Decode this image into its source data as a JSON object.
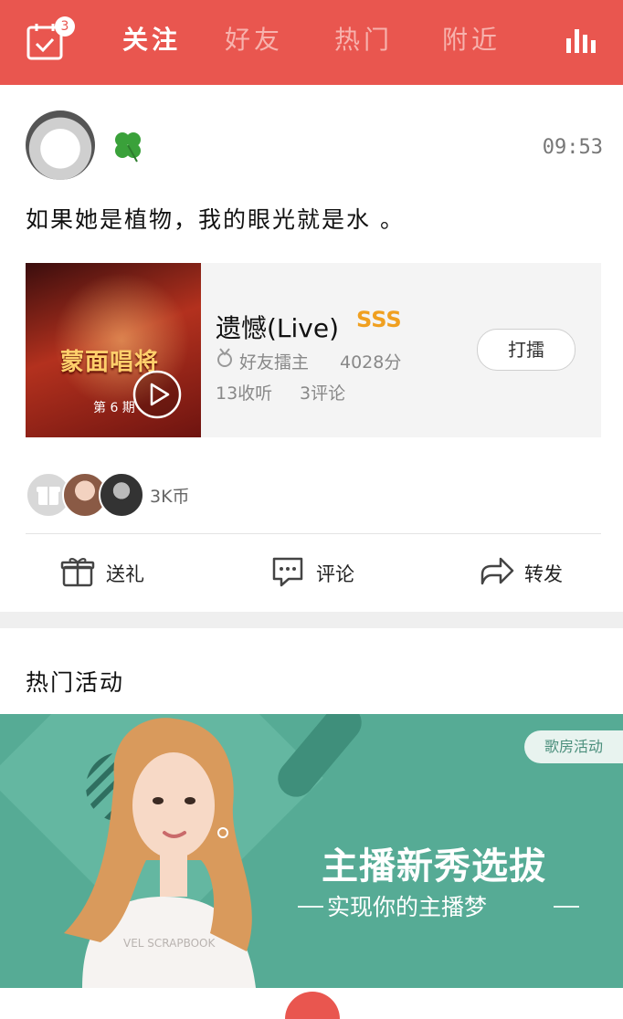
{
  "topbar": {
    "checkin_badge": "3",
    "tabs": [
      {
        "label": "关注",
        "active": true
      },
      {
        "label": "好友",
        "active": false
      },
      {
        "label": "热门",
        "active": false
      },
      {
        "label": "附近",
        "active": false
      }
    ],
    "icons": {
      "left": "calendar-check-icon",
      "right": "bar-chart-icon"
    }
  },
  "post": {
    "time": "09:53",
    "text": "如果她是植物，我的眼光就是水 。",
    "song": {
      "cover_title": "蒙面唱将",
      "cover_episode": "第 6 期",
      "title": "遗憾(Live)",
      "rank": "SSS",
      "uploader": "好友擂主",
      "score": "4028分",
      "listens": "13收听",
      "comments": "3评论",
      "hit_label": "打擂"
    },
    "gifts": {
      "coins": "3K币"
    },
    "actions": [
      {
        "label": "送礼",
        "icon": "gift-icon"
      },
      {
        "label": "评论",
        "icon": "comment-icon"
      },
      {
        "label": "转发",
        "icon": "share-icon"
      }
    ]
  },
  "hot_activities": {
    "title": "热门活动",
    "banner": {
      "tag": "歌房活动",
      "title": "主播新秀选拔",
      "subtitle": "实现你的主播梦",
      "shirt_text": "VEL SCRAPBOOK"
    }
  },
  "colors": {
    "accent": "#e9564f",
    "banner": "#56ab95",
    "rank": "#f0a020"
  }
}
